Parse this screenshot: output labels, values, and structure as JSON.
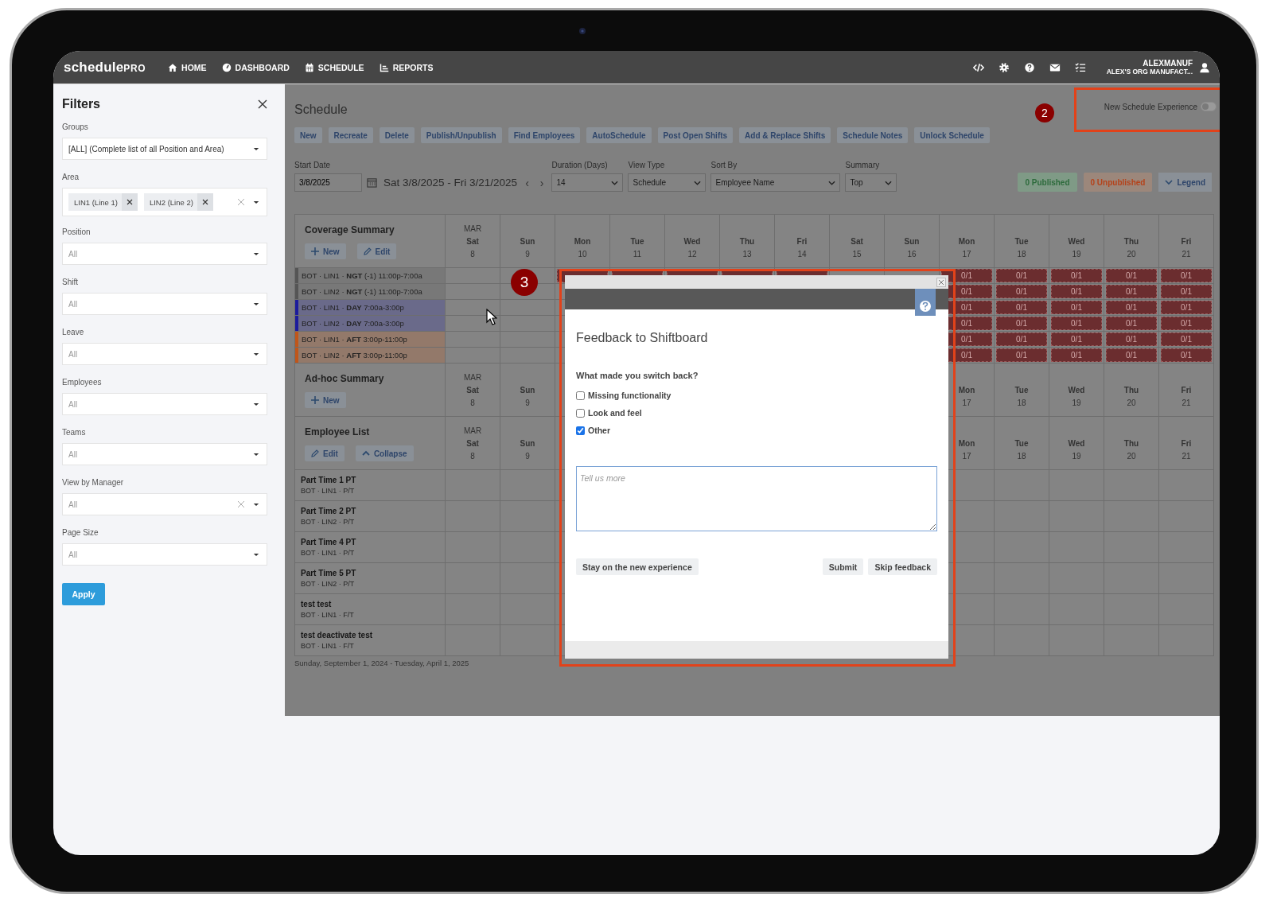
{
  "navbar": {
    "logo": "schedule",
    "logo_suffix": "PRO",
    "items": [
      {
        "label": "HOME"
      },
      {
        "label": "DASHBOARD"
      },
      {
        "label": "SCHEDULE"
      },
      {
        "label": "REPORTS"
      }
    ],
    "user": {
      "name": "ALEXMANUF",
      "org": "ALEX'S ORG MANUFACT..."
    }
  },
  "filters": {
    "title": "Filters",
    "fields": [
      {
        "label": "Groups",
        "kind": "select",
        "value": "[ALL] (Complete list of all Position and Area)",
        "clearable": false
      },
      {
        "label": "Area",
        "kind": "tags",
        "tags": [
          "LIN1 (Line 1)",
          "LIN2 (Line 2)"
        ],
        "clearable": true
      },
      {
        "label": "Position",
        "kind": "select",
        "placeholder": "All",
        "clearable": false
      },
      {
        "label": "Shift",
        "kind": "select",
        "placeholder": "All",
        "clearable": false
      },
      {
        "label": "Leave",
        "kind": "select",
        "placeholder": "All",
        "clearable": false
      },
      {
        "label": "Employees",
        "kind": "select",
        "placeholder": "All",
        "clearable": false
      },
      {
        "label": "Teams",
        "kind": "select",
        "placeholder": "All",
        "clearable": false
      },
      {
        "label": "View by Manager",
        "kind": "select",
        "placeholder": "All",
        "clearable": true
      },
      {
        "label": "Page Size",
        "kind": "select",
        "placeholder": "All",
        "clearable": false
      }
    ],
    "apply": "Apply"
  },
  "schedule": {
    "title": "Schedule",
    "new_experience": {
      "label": "New Schedule Experience",
      "on": false
    },
    "actions": [
      "New",
      "Recreate",
      "Delete",
      "Publish/Unpublish",
      "Find Employees",
      "AutoSchedule",
      "Post Open Shifts",
      "Add & Replace Shifts",
      "Schedule Notes",
      "Unlock Schedule"
    ],
    "start_date": {
      "label": "Start Date",
      "value": "3/8/2025"
    },
    "range": "Sat 3/8/2025  -  Fri 3/21/2025",
    "prev": "‹",
    "next": "›",
    "selects": [
      {
        "label": "Duration (Days)",
        "value": "14"
      },
      {
        "label": "View Type",
        "value": "Schedule"
      },
      {
        "label": "Sort By",
        "value": "Employee Name"
      },
      {
        "label": "Summary",
        "value": "Top"
      }
    ],
    "badges": [
      {
        "text": "0 Published",
        "kind": "published"
      },
      {
        "text": "0 Unpublished",
        "kind": "unpublished"
      }
    ],
    "legend": "Legend"
  },
  "coverage": {
    "title": "Coverage Summary",
    "actions": [
      {
        "label": "New",
        "kind": "add"
      },
      {
        "label": "Edit",
        "kind": "edit"
      }
    ],
    "days": [
      {
        "month": "MAR",
        "weekday": "Sat",
        "date": "8"
      },
      {
        "weekday": "Sun",
        "date": "9"
      },
      {
        "weekday": "Mon",
        "date": "10"
      },
      {
        "weekday": "Tue",
        "date": "11"
      },
      {
        "weekday": "Wed",
        "date": "12"
      },
      {
        "weekday": "Thu",
        "date": "13"
      },
      {
        "weekday": "Fri",
        "date": "14"
      },
      {
        "weekday": "Sat",
        "date": "15"
      },
      {
        "weekday": "Sun",
        "date": "16"
      },
      {
        "weekday": "Mon",
        "date": "17"
      },
      {
        "weekday": "Tue",
        "date": "18"
      },
      {
        "weekday": "Wed",
        "date": "19"
      },
      {
        "weekday": "Thu",
        "date": "20"
      },
      {
        "weekday": "Fri",
        "date": "21"
      }
    ],
    "rows": [
      {
        "text": "BOT · LIN1 · **NGT** (-1) 11:00p-7:00a",
        "color": "#555555",
        "cells": [
          {
            "kind": "empty"
          },
          {
            "kind": "empty"
          },
          {
            "kind": "open"
          },
          {
            "kind": "open"
          },
          {
            "kind": "open"
          },
          {
            "kind": "open"
          },
          {
            "kind": "open"
          },
          {
            "kind": "empty"
          },
          {
            "kind": "empty"
          },
          {
            "kind": "open",
            "text": "0/1"
          },
          {
            "kind": "open",
            "text": "0/1"
          },
          {
            "kind": "open",
            "text": "0/1"
          },
          {
            "kind": "open",
            "text": "0/1"
          },
          {
            "kind": "open",
            "text": "0/1"
          }
        ]
      },
      {
        "text": "BOT · LIN2 · **NGT** (-1) 11:00p-7:00a",
        "color": "#555555",
        "cells": [
          {
            "kind": "empty"
          },
          {
            "kind": "empty"
          },
          {
            "kind": "empty"
          },
          {
            "kind": "empty"
          },
          {
            "kind": "empty"
          },
          {
            "kind": "empty"
          },
          {
            "kind": "empty"
          },
          {
            "kind": "empty"
          },
          {
            "kind": "empty"
          },
          {
            "kind": "open",
            "text": "0/1"
          },
          {
            "kind": "open",
            "text": "0/1"
          },
          {
            "kind": "open",
            "text": "0/1"
          },
          {
            "kind": "open",
            "text": "0/1"
          },
          {
            "kind": "open",
            "text": "0/1"
          }
        ]
      },
      {
        "text": "BOT · LIN1 · **DAY** 7:00a-3:00p",
        "color": "#1c1c9c",
        "cells": [
          {
            "kind": "empty"
          },
          {
            "kind": "empty"
          },
          {
            "kind": "empty"
          },
          {
            "kind": "empty"
          },
          {
            "kind": "empty"
          },
          {
            "kind": "empty"
          },
          {
            "kind": "empty"
          },
          {
            "kind": "empty"
          },
          {
            "kind": "empty"
          },
          {
            "kind": "open",
            "text": "0/1"
          },
          {
            "kind": "open",
            "text": "0/1"
          },
          {
            "kind": "open",
            "text": "0/1"
          },
          {
            "kind": "open",
            "text": "0/1"
          },
          {
            "kind": "open",
            "text": "0/1"
          }
        ]
      },
      {
        "text": "BOT · LIN2 · **DAY** 7:00a-3:00p",
        "color": "#1c1c9c",
        "cells": [
          {
            "kind": "empty"
          },
          {
            "kind": "empty"
          },
          {
            "kind": "empty"
          },
          {
            "kind": "empty"
          },
          {
            "kind": "empty"
          },
          {
            "kind": "empty"
          },
          {
            "kind": "empty"
          },
          {
            "kind": "empty"
          },
          {
            "kind": "empty"
          },
          {
            "kind": "open",
            "text": "0/1"
          },
          {
            "kind": "open",
            "text": "0/1"
          },
          {
            "kind": "open",
            "text": "0/1"
          },
          {
            "kind": "open",
            "text": "0/1"
          },
          {
            "kind": "open",
            "text": "0/1"
          }
        ]
      },
      {
        "text": "BOT · LIN1 · **AFT** 3:00p-11:00p",
        "color": "#c0561a",
        "cells": [
          {
            "kind": "empty"
          },
          {
            "kind": "empty"
          },
          {
            "kind": "empty"
          },
          {
            "kind": "empty"
          },
          {
            "kind": "empty"
          },
          {
            "kind": "empty"
          },
          {
            "kind": "empty"
          },
          {
            "kind": "empty"
          },
          {
            "kind": "empty"
          },
          {
            "kind": "open",
            "text": "0/1"
          },
          {
            "kind": "open",
            "text": "0/1"
          },
          {
            "kind": "open",
            "text": "0/1"
          },
          {
            "kind": "open",
            "text": "0/1"
          },
          {
            "kind": "open",
            "text": "0/1"
          }
        ]
      },
      {
        "text": "BOT · LIN2 · **AFT** 3:00p-11:00p",
        "color": "#c0561a",
        "cells": [
          {
            "kind": "empty"
          },
          {
            "kind": "empty"
          },
          {
            "kind": "empty"
          },
          {
            "kind": "empty"
          },
          {
            "kind": "empty"
          },
          {
            "kind": "empty"
          },
          {
            "kind": "empty"
          },
          {
            "kind": "empty"
          },
          {
            "kind": "empty"
          },
          {
            "kind": "open",
            "text": "0/1"
          },
          {
            "kind": "open",
            "text": "0/1"
          },
          {
            "kind": "open",
            "text": "0/1"
          },
          {
            "kind": "open",
            "text": "0/1"
          },
          {
            "kind": "open",
            "text": "0/1"
          }
        ]
      }
    ]
  },
  "adhoc": {
    "title": "Ad-hoc Summary",
    "actions": [
      {
        "label": "New",
        "kind": "add"
      }
    ],
    "days": [
      {
        "month": "MAR",
        "weekday": "Sat",
        "date": "8"
      },
      {
        "weekday": "Sun",
        "date": "9"
      },
      {
        "weekday": "Mon",
        "date": "17"
      },
      {
        "weekday": "Tue",
        "date": "18"
      },
      {
        "weekday": "Wed",
        "date": "19"
      },
      {
        "weekday": "Thu",
        "date": "20"
      },
      {
        "weekday": "Fri",
        "date": "21"
      }
    ]
  },
  "employees": {
    "title": "Employee List",
    "actions": [
      {
        "label": "Edit",
        "kind": "edit"
      },
      {
        "label": "Collapse",
        "kind": "collapse"
      }
    ],
    "days": [
      {
        "month": "MAR",
        "weekday": "Sat",
        "date": "8"
      },
      {
        "weekday": "Sun",
        "date": "9"
      },
      {
        "weekday": "Mon",
        "date": "17"
      },
      {
        "weekday": "Tue",
        "date": "18"
      },
      {
        "weekday": "Wed",
        "date": "19"
      },
      {
        "weekday": "Thu",
        "date": "20"
      },
      {
        "weekday": "Fri",
        "date": "21"
      }
    ],
    "rows": [
      {
        "name": "Part Time 1 PT",
        "detail": "BOT · LIN1 · P/T"
      },
      {
        "name": "Part Time 2 PT",
        "detail": "BOT · LIN2 · P/T"
      },
      {
        "name": "Part Time 4 PT",
        "detail": "BOT · LIN1 · P/T"
      },
      {
        "name": "Part Time 5 PT",
        "detail": "BOT · LIN2 · P/T"
      },
      {
        "name": "test test",
        "detail": "BOT · LIN1 · F/T"
      },
      {
        "name": "test deactivate test",
        "detail": "BOT · LIN1 · F/T"
      }
    ]
  },
  "date_span": "Sunday, September 1, 2024 - Tuesday, April 1, 2025",
  "dialog": {
    "title": "Feedback to Shiftboard",
    "question": "What made you switch back?",
    "options": [
      {
        "label": "Missing functionality",
        "checked": false
      },
      {
        "label": "Look and feel",
        "checked": false
      },
      {
        "label": "Other",
        "checked": true
      }
    ],
    "comment": {
      "placeholder": "Tell us more"
    },
    "buttons": [
      "Stay on the new experience",
      "Submit",
      "Skip feedback"
    ]
  },
  "annotations": [
    {
      "label": "2"
    },
    {
      "label": "3"
    }
  ]
}
